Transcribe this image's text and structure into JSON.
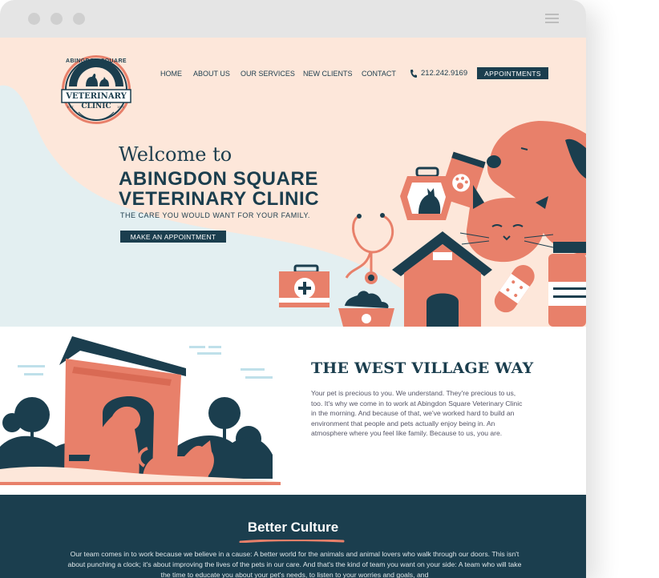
{
  "nav": {
    "items": [
      {
        "label": "HOME"
      },
      {
        "label": "ABOUT US"
      },
      {
        "label": "OUR SERVICES"
      },
      {
        "label": "NEW CLIENTS"
      },
      {
        "label": "CONTACT"
      }
    ],
    "phone": "212.242.9169",
    "appointments_label": "APPOINTMENTS"
  },
  "logo": {
    "top_arc": "ABINGDON SQUARE",
    "line1": "VETERINARY",
    "line2": "CLINIC",
    "est": "EST.",
    "year": "1970"
  },
  "hero": {
    "welcome": "Welcome to",
    "name_line1": "ABINGDON SQUARE",
    "name_line2": "VETERINARY CLINIC",
    "tagline": "THE CARE YOU WOULD WANT FOR YOUR FAMILY.",
    "cta_label": "MAKE AN APPOINTMENT"
  },
  "west": {
    "title": "THE WEST VILLAGE WAY",
    "body": "Your pet is precious to you. We understand. They're precious to us, too. It's why we come in to work at Abingdon Square Veterinary Clinic in the morning. And because of that, we've worked hard to build an environment that people and pets actually enjoy being in. An atmosphere where you feel like family. Because to us, you are."
  },
  "culture": {
    "title": "Better Culture",
    "body": "Our team comes in to work because we believe in a cause: A better world for the animals and animal lovers who walk through our doors. This isn't about punching a clock; it's about improving the lives of the pets in our care. And that's the kind of team you want on your side: A team who will take the time to educate you about your pet's needs, to listen to your worries and goals, and"
  },
  "colors": {
    "navy": "#1b3e4e",
    "coral": "#e8806a",
    "peach": "#fde7da",
    "light_blue": "#e3eff1"
  }
}
